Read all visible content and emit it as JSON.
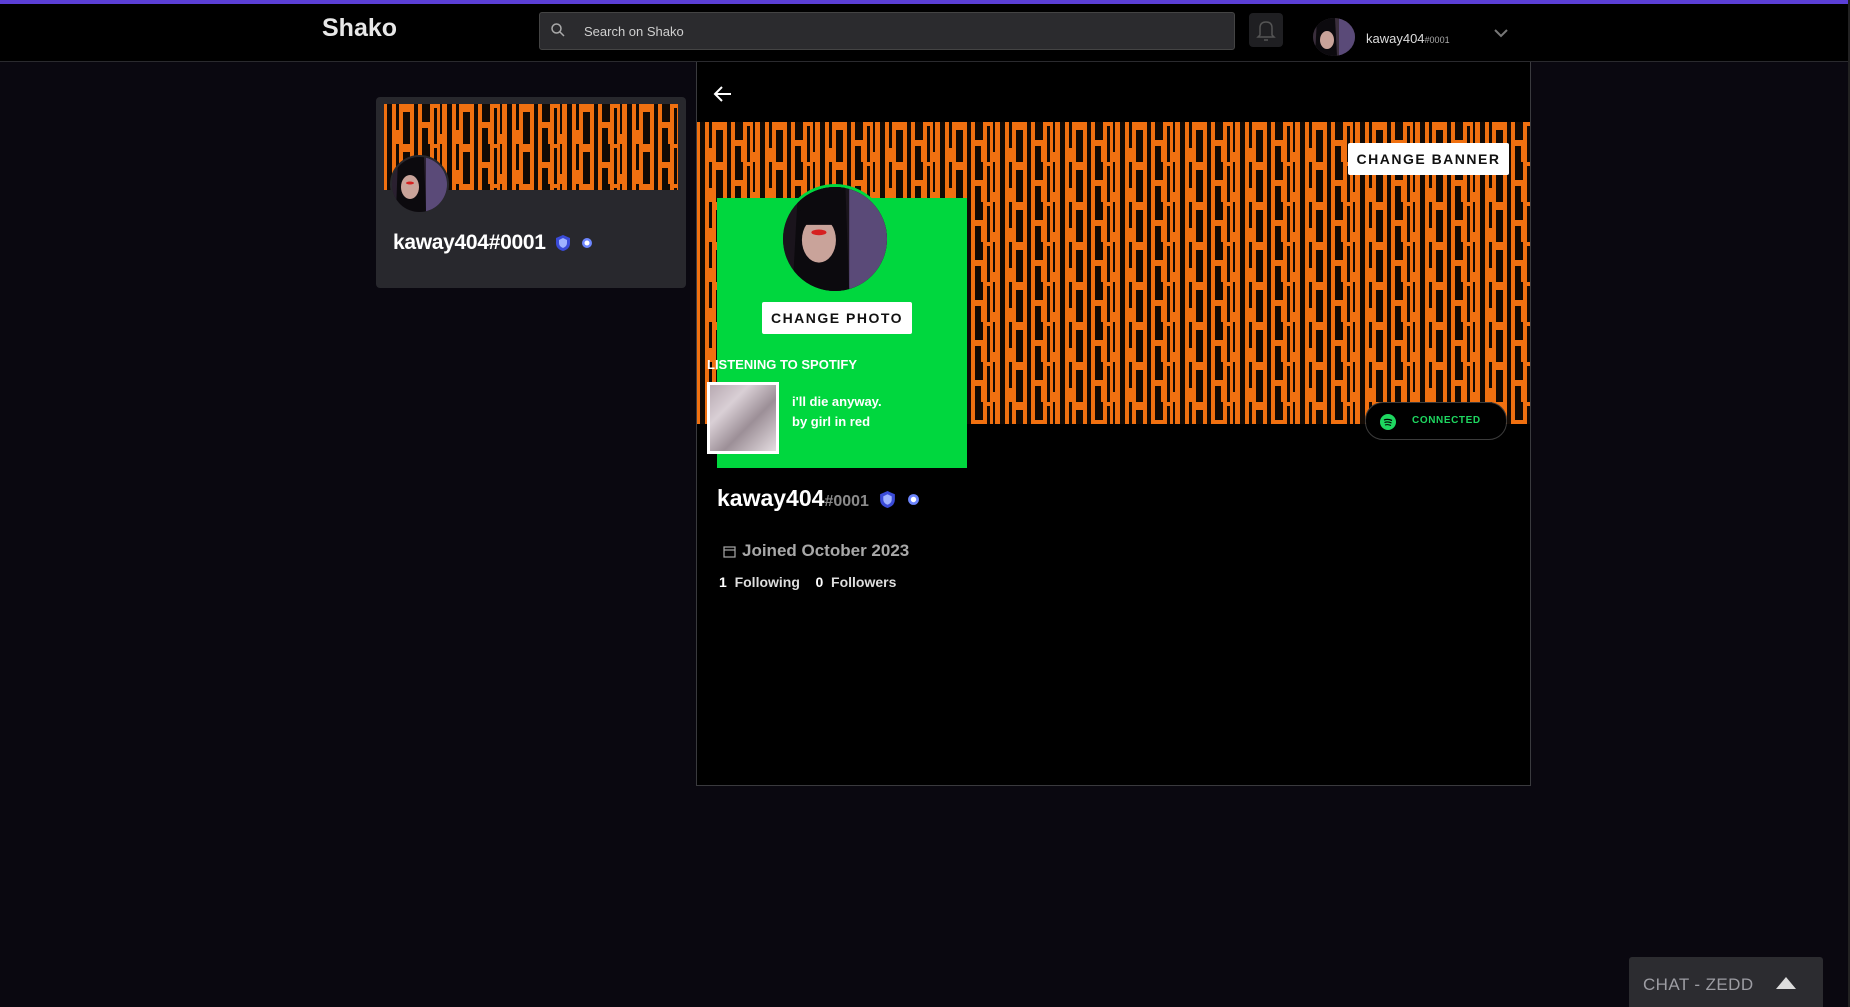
{
  "app": {
    "title": "Shako"
  },
  "search": {
    "placeholder": "Search on Shako"
  },
  "header": {
    "user_name": "kaway404",
    "user_tag": "#0001"
  },
  "sidebar_card": {
    "display_name": "kaway404#0001"
  },
  "profile": {
    "change_banner_label": "CHANGE BANNER",
    "change_photo_label": "CHANGE PHOTO",
    "spotify": {
      "heading": "LISTENING TO SPOTIFY",
      "track": "i'll die anyway.",
      "artist_line": "by girl in red",
      "connected_label": "CONNECTED"
    },
    "username": "kaway404",
    "tag": "#0001",
    "joined": "Joined October 2023",
    "following_count": "1",
    "following_label": "Following",
    "followers_count": "0",
    "followers_label": "Followers"
  },
  "chat": {
    "label": "CHAT - ZEDD"
  },
  "colors": {
    "accent": "#5b3fd6",
    "spotify_green": "#00d73e",
    "banner_orange": "#f07010"
  },
  "icons": [
    "search-icon",
    "bell-icon",
    "chevron-down-icon",
    "back-arrow-icon",
    "shield-badge-icon",
    "calendar-icon",
    "spotify-icon",
    "triangle-up-icon"
  ]
}
